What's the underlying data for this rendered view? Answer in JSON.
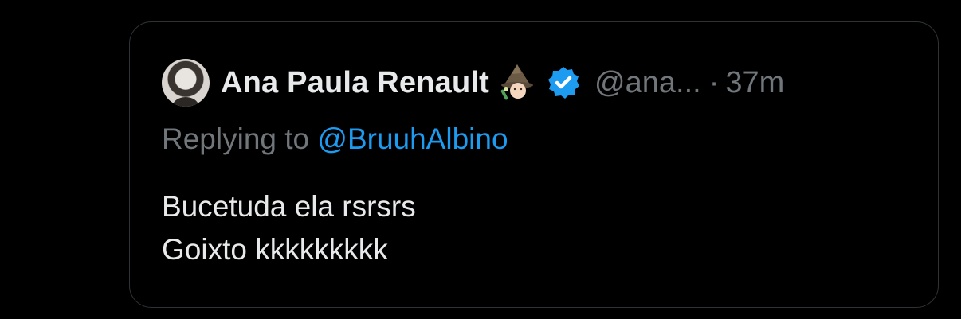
{
  "tweet": {
    "display_name": "Ana Paula Renault",
    "name_emoji": "wizard-emoji",
    "verified_icon": "verified-badge-icon",
    "handle": "@ana...",
    "separator": "·",
    "time": "37m",
    "replying_prefix": "Replying to",
    "replying_handle": "@BruuhAlbino",
    "body_lines": [
      "Bucetuda ela rsrsrs",
      "Goixto kkkkkkkkk"
    ]
  },
  "colors": {
    "background": "#000000",
    "border": "#2f3336",
    "primary_text": "#e7e9ea",
    "secondary_text": "#71767b",
    "link": "#1d9bf0",
    "verified": "#1d9bf0"
  }
}
